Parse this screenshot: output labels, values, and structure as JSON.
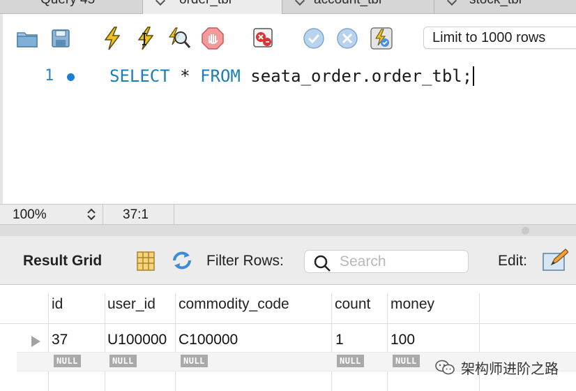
{
  "tabs": [
    {
      "label": "Query 45",
      "active": false
    },
    {
      "label": "order_tbl",
      "active": true
    },
    {
      "label": "account_tbl",
      "active": false
    },
    {
      "label": "stock_tbl",
      "active": false
    }
  ],
  "toolbar": {
    "buttons": [
      "open-file-icon",
      "save-icon",
      "execute-icon",
      "execute-current-icon",
      "explain-icon",
      "stop-icon",
      "toggle-error-icon",
      "commit-icon",
      "rollback-icon",
      "autocommit-icon"
    ],
    "limit_value": "Limit to 1000 rows"
  },
  "editor": {
    "line_number": "1",
    "code": {
      "kw1": "SELECT",
      "star": " * ",
      "kw2": "FROM",
      "rest": " seata_order.order_tbl;"
    }
  },
  "status": {
    "zoom": "100%",
    "position": "37:1"
  },
  "result_toolbar": {
    "title": "Result Grid",
    "filter_label": "Filter Rows:",
    "search_placeholder": "Search",
    "edit_label": "Edit:"
  },
  "grid": {
    "columns": [
      "id",
      "user_id",
      "commodity_code",
      "count",
      "money"
    ],
    "rows": [
      [
        "37",
        "U100000",
        "C100000",
        "1",
        "100"
      ]
    ],
    "null_label": "NULL"
  },
  "watermark": {
    "text": "架构师进阶之路"
  },
  "colors": {
    "keyword": "#1a7fb8",
    "line_number": "#2f86c8",
    "accent": "#1c7fd6"
  }
}
